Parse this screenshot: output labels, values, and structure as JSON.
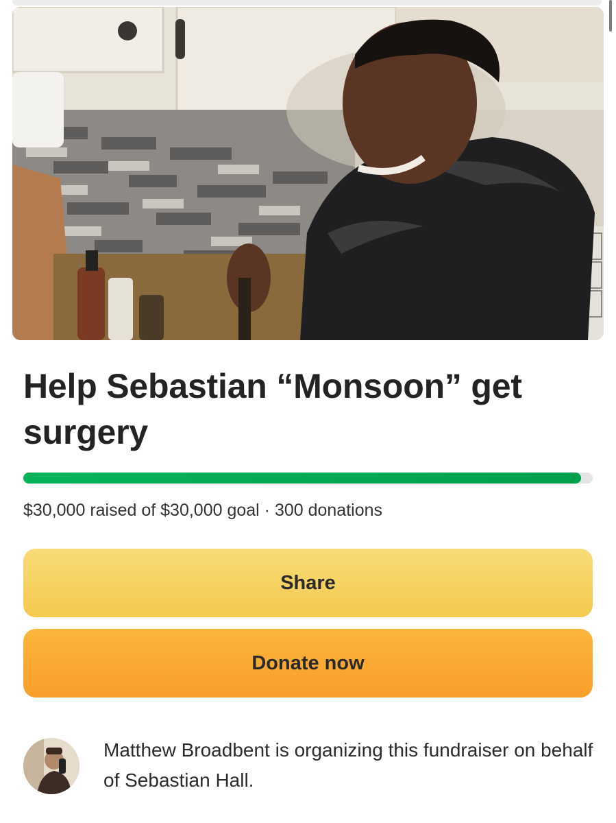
{
  "campaign": {
    "title": "Help Sebastian “Monsoon” get surgery",
    "raised": "$30,000",
    "goal": "$30,000",
    "donations": "300 donations",
    "stats_text": "$30,000 raised of $30,000 goal · 300 donations",
    "progress_fraction": 0.98
  },
  "actions": {
    "share_label": "Share",
    "donate_label": "Donate now"
  },
  "organizer": {
    "text": "Matthew Broadbent is organizing this fundraiser on behalf of Sebastian Hall."
  },
  "colors": {
    "progress": "#02a04c",
    "share_button": "#f4c94e",
    "donate_button": "#f99e2b"
  },
  "icons": {
    "hero": "campaign-photo",
    "avatar": "organizer-avatar"
  }
}
